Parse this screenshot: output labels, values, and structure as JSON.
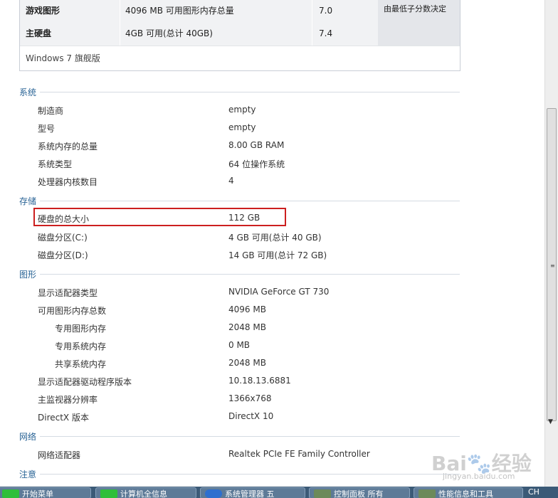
{
  "rating_table": {
    "rows": [
      {
        "name": "游戏图形",
        "detail": "4096 MB 可用图形内存总量",
        "score": "7.0"
      },
      {
        "name": "主硬盘",
        "detail": "4GB 可用(总计 40GB)",
        "score": "7.4"
      }
    ],
    "note": "由最低子分数决定",
    "os": "Windows 7 旗舰版"
  },
  "system": {
    "title": "系统",
    "rows": [
      {
        "label": "制造商",
        "value": "empty"
      },
      {
        "label": "型号",
        "value": "empty"
      },
      {
        "label": "系统内存的总量",
        "value": "8.00 GB RAM"
      },
      {
        "label": "系统类型",
        "value": "64 位操作系统"
      },
      {
        "label": "处理器内核数目",
        "value": "4"
      }
    ]
  },
  "storage": {
    "title": "存储",
    "rows": [
      {
        "label": "硬盘的总大小",
        "value": "112 GB"
      },
      {
        "label": "磁盘分区(C:)",
        "value": "4 GB 可用(总计 40 GB)"
      },
      {
        "label": "磁盘分区(D:)",
        "value": "14 GB 可用(总计 72 GB)"
      }
    ]
  },
  "graphics": {
    "title": "图形",
    "rows": [
      {
        "label": "显示适配器类型",
        "value": "NVIDIA GeForce GT 730"
      },
      {
        "label": "可用图形内存总数",
        "value": "4096 MB"
      },
      {
        "label": "专用图形内存",
        "value": "2048 MB"
      },
      {
        "label": "专用系统内存",
        "value": "0 MB"
      },
      {
        "label": "共享系统内存",
        "value": "2048 MB"
      },
      {
        "label": "显示适配器驱动程序版本",
        "value": "10.18.13.6881"
      },
      {
        "label": "主监视器分辨率",
        "value": "1366x768"
      },
      {
        "label": "DirectX 版本",
        "value": "DirectX 10"
      }
    ]
  },
  "network": {
    "title": "网络",
    "rows": [
      {
        "label": "网络适配器",
        "value": "Realtek PCIe FE Family Controller"
      }
    ]
  },
  "notes": {
    "title": "注意"
  },
  "taskbar": {
    "items": [
      {
        "label": "开始菜单"
      },
      {
        "label": "计算机全信息"
      },
      {
        "label": "系统管理器 五"
      },
      {
        "label": "控制面板 所有"
      },
      {
        "label": "性能信息和工具"
      }
    ],
    "tray": "CH"
  },
  "watermark": {
    "text": "Bai🐾经验",
    "sub": "jingyan.baidu.com"
  },
  "colors": {
    "section": "#2a6496",
    "highlight": "#cc1f1f"
  }
}
